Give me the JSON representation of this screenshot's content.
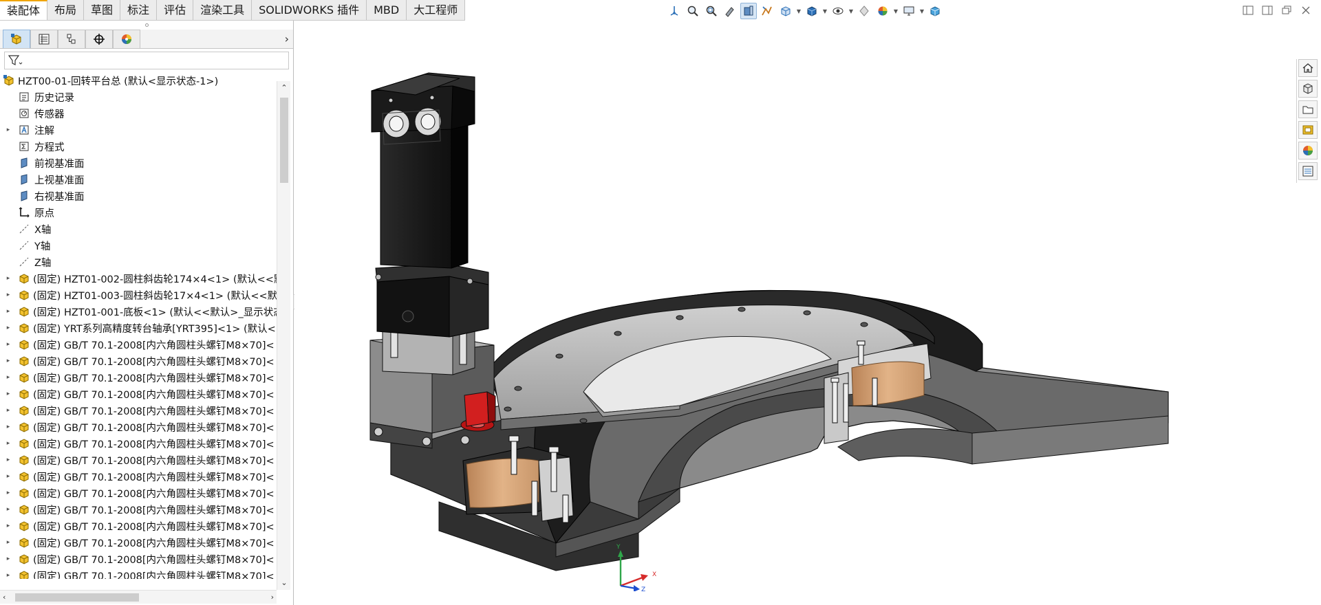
{
  "tabs": [
    {
      "label": "装配体",
      "active": true
    },
    {
      "label": "布局"
    },
    {
      "label": "草图"
    },
    {
      "label": "标注"
    },
    {
      "label": "评估"
    },
    {
      "label": "渲染工具"
    },
    {
      "label": "SOLIDWORKS 插件"
    },
    {
      "label": "MBD"
    },
    {
      "label": "大工程师"
    }
  ],
  "heads_up_toolbar": [
    "view-orientation-icon",
    "zoom-to-fit-icon",
    "zoom-to-area-icon",
    "previous-view-icon",
    "section-view-icon",
    "dynamic-annotation-icon",
    "view-orientation-dropdown-icon",
    "display-style-icon",
    "hide-show-items-icon",
    "edit-appearance-icon",
    "apply-scene-icon",
    "view-settings-icon",
    "3d-view-cube-icon"
  ],
  "manager_tabs": [
    "featuremanager-icon",
    "propertymanager-icon",
    "configurationmanager-icon",
    "dimxpertmanager-icon",
    "displaymanager-icon"
  ],
  "tree": {
    "root": "HZT00-01-回转平台总  (默认<显示状态-1>)",
    "fixed_prefix": "(固定)",
    "items": [
      {
        "label": "历史记录",
        "icon": "history-icon",
        "expand": false
      },
      {
        "label": "传感器",
        "icon": "sensor-icon",
        "expand": false
      },
      {
        "label": "注解",
        "icon": "annotation-icon",
        "expand": true
      },
      {
        "label": "方程式",
        "icon": "equation-icon",
        "expand": false
      },
      {
        "label": "前视基准面",
        "icon": "plane-icon",
        "expand": false
      },
      {
        "label": "上视基准面",
        "icon": "plane-icon",
        "expand": false
      },
      {
        "label": "右视基准面",
        "icon": "plane-icon",
        "expand": false
      },
      {
        "label": "原点",
        "icon": "origin-icon",
        "expand": false
      },
      {
        "label": "X轴",
        "icon": "axis-icon",
        "expand": false
      },
      {
        "label": "Y轴",
        "icon": "axis-icon",
        "expand": false
      },
      {
        "label": "Z轴",
        "icon": "axis-icon",
        "expand": false
      },
      {
        "label": "HZT01-002-圆柱斜齿轮174×4<1> (默认<<默",
        "icon": "part-icon",
        "expand": true,
        "fixed": true
      },
      {
        "label": "HZT01-003-圆柱斜齿轮17×4<1> (默认<<默认",
        "icon": "part-icon",
        "expand": true,
        "fixed": true
      },
      {
        "label": "HZT01-001-底板<1> (默认<<默认>_显示状态",
        "icon": "part-icon",
        "expand": true,
        "fixed": true
      },
      {
        "label": "YRT系列高精度转台轴承[YRT395]<1> (默认<",
        "icon": "part-icon",
        "expand": true,
        "fixed": true
      },
      {
        "label": "GB/T 70.1-2008[内六角圆柱头螺钉M8×70]<",
        "icon": "part-icon",
        "expand": true,
        "fixed": true
      },
      {
        "label": "GB/T 70.1-2008[内六角圆柱头螺钉M8×70]<",
        "icon": "part-icon",
        "expand": true,
        "fixed": true
      },
      {
        "label": "GB/T 70.1-2008[内六角圆柱头螺钉M8×70]<",
        "icon": "part-icon",
        "expand": true,
        "fixed": true
      },
      {
        "label": "GB/T 70.1-2008[内六角圆柱头螺钉M8×70]<",
        "icon": "part-icon",
        "expand": true,
        "fixed": true
      },
      {
        "label": "GB/T 70.1-2008[内六角圆柱头螺钉M8×70]<",
        "icon": "part-icon",
        "expand": true,
        "fixed": true
      },
      {
        "label": "GB/T 70.1-2008[内六角圆柱头螺钉M8×70]<",
        "icon": "part-icon",
        "expand": true,
        "fixed": true
      },
      {
        "label": "GB/T 70.1-2008[内六角圆柱头螺钉M8×70]<",
        "icon": "part-icon",
        "expand": true,
        "fixed": true
      },
      {
        "label": "GB/T 70.1-2008[内六角圆柱头螺钉M8×70]<",
        "icon": "part-icon",
        "expand": true,
        "fixed": true
      },
      {
        "label": "GB/T 70.1-2008[内六角圆柱头螺钉M8×70]<",
        "icon": "part-icon",
        "expand": true,
        "fixed": true
      },
      {
        "label": "GB/T 70.1-2008[内六角圆柱头螺钉M8×70]<",
        "icon": "part-icon",
        "expand": true,
        "fixed": true
      },
      {
        "label": "GB/T 70.1-2008[内六角圆柱头螺钉M8×70]<",
        "icon": "part-icon",
        "expand": true,
        "fixed": true
      },
      {
        "label": "GB/T 70.1-2008[内六角圆柱头螺钉M8×70]<",
        "icon": "part-icon",
        "expand": true,
        "fixed": true
      },
      {
        "label": "GB/T 70.1-2008[内六角圆柱头螺钉M8×70]<",
        "icon": "part-icon",
        "expand": true,
        "fixed": true
      },
      {
        "label": "GB/T 70.1-2008[内六角圆柱头螺钉M8×70]<",
        "icon": "part-icon",
        "expand": true,
        "fixed": true
      },
      {
        "label": "GB/T 70.1-2008[内六角圆柱头螺钉M8×70]<",
        "icon": "part-icon",
        "expand": true,
        "fixed": true
      }
    ]
  },
  "triad": {
    "x": "X",
    "y": "Y",
    "z": "Z"
  },
  "taskpane": [
    "home-icon",
    "design-library-icon",
    "file-explorer-icon",
    "view-palette-icon",
    "appearances-icon",
    "custom-properties-icon"
  ],
  "colors": {
    "accent_tab": "#f0a500",
    "part_icon": "#f2c12e",
    "selected_part": "#d21f1f",
    "wood": "#d9a577",
    "model_dark": "#1b1b1b",
    "model_gray": "#b9b9b9"
  }
}
